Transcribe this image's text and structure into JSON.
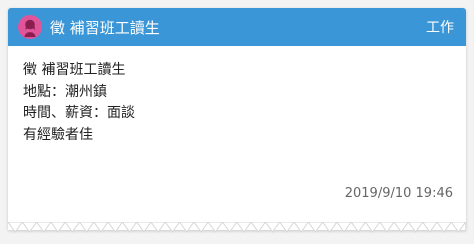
{
  "post": {
    "title": "徵 補習班工讀生",
    "category": "工作",
    "lines": [
      "徵 補習班工讀生",
      "地點：潮州鎮",
      "時間、薪資：面談",
      "有經驗者佳"
    ],
    "timestamp": "2019/9/10 19:46"
  },
  "colors": {
    "header": "#3a96d6",
    "avatar": "#e0559a"
  },
  "icons": {
    "avatar": "female-avatar-icon"
  }
}
